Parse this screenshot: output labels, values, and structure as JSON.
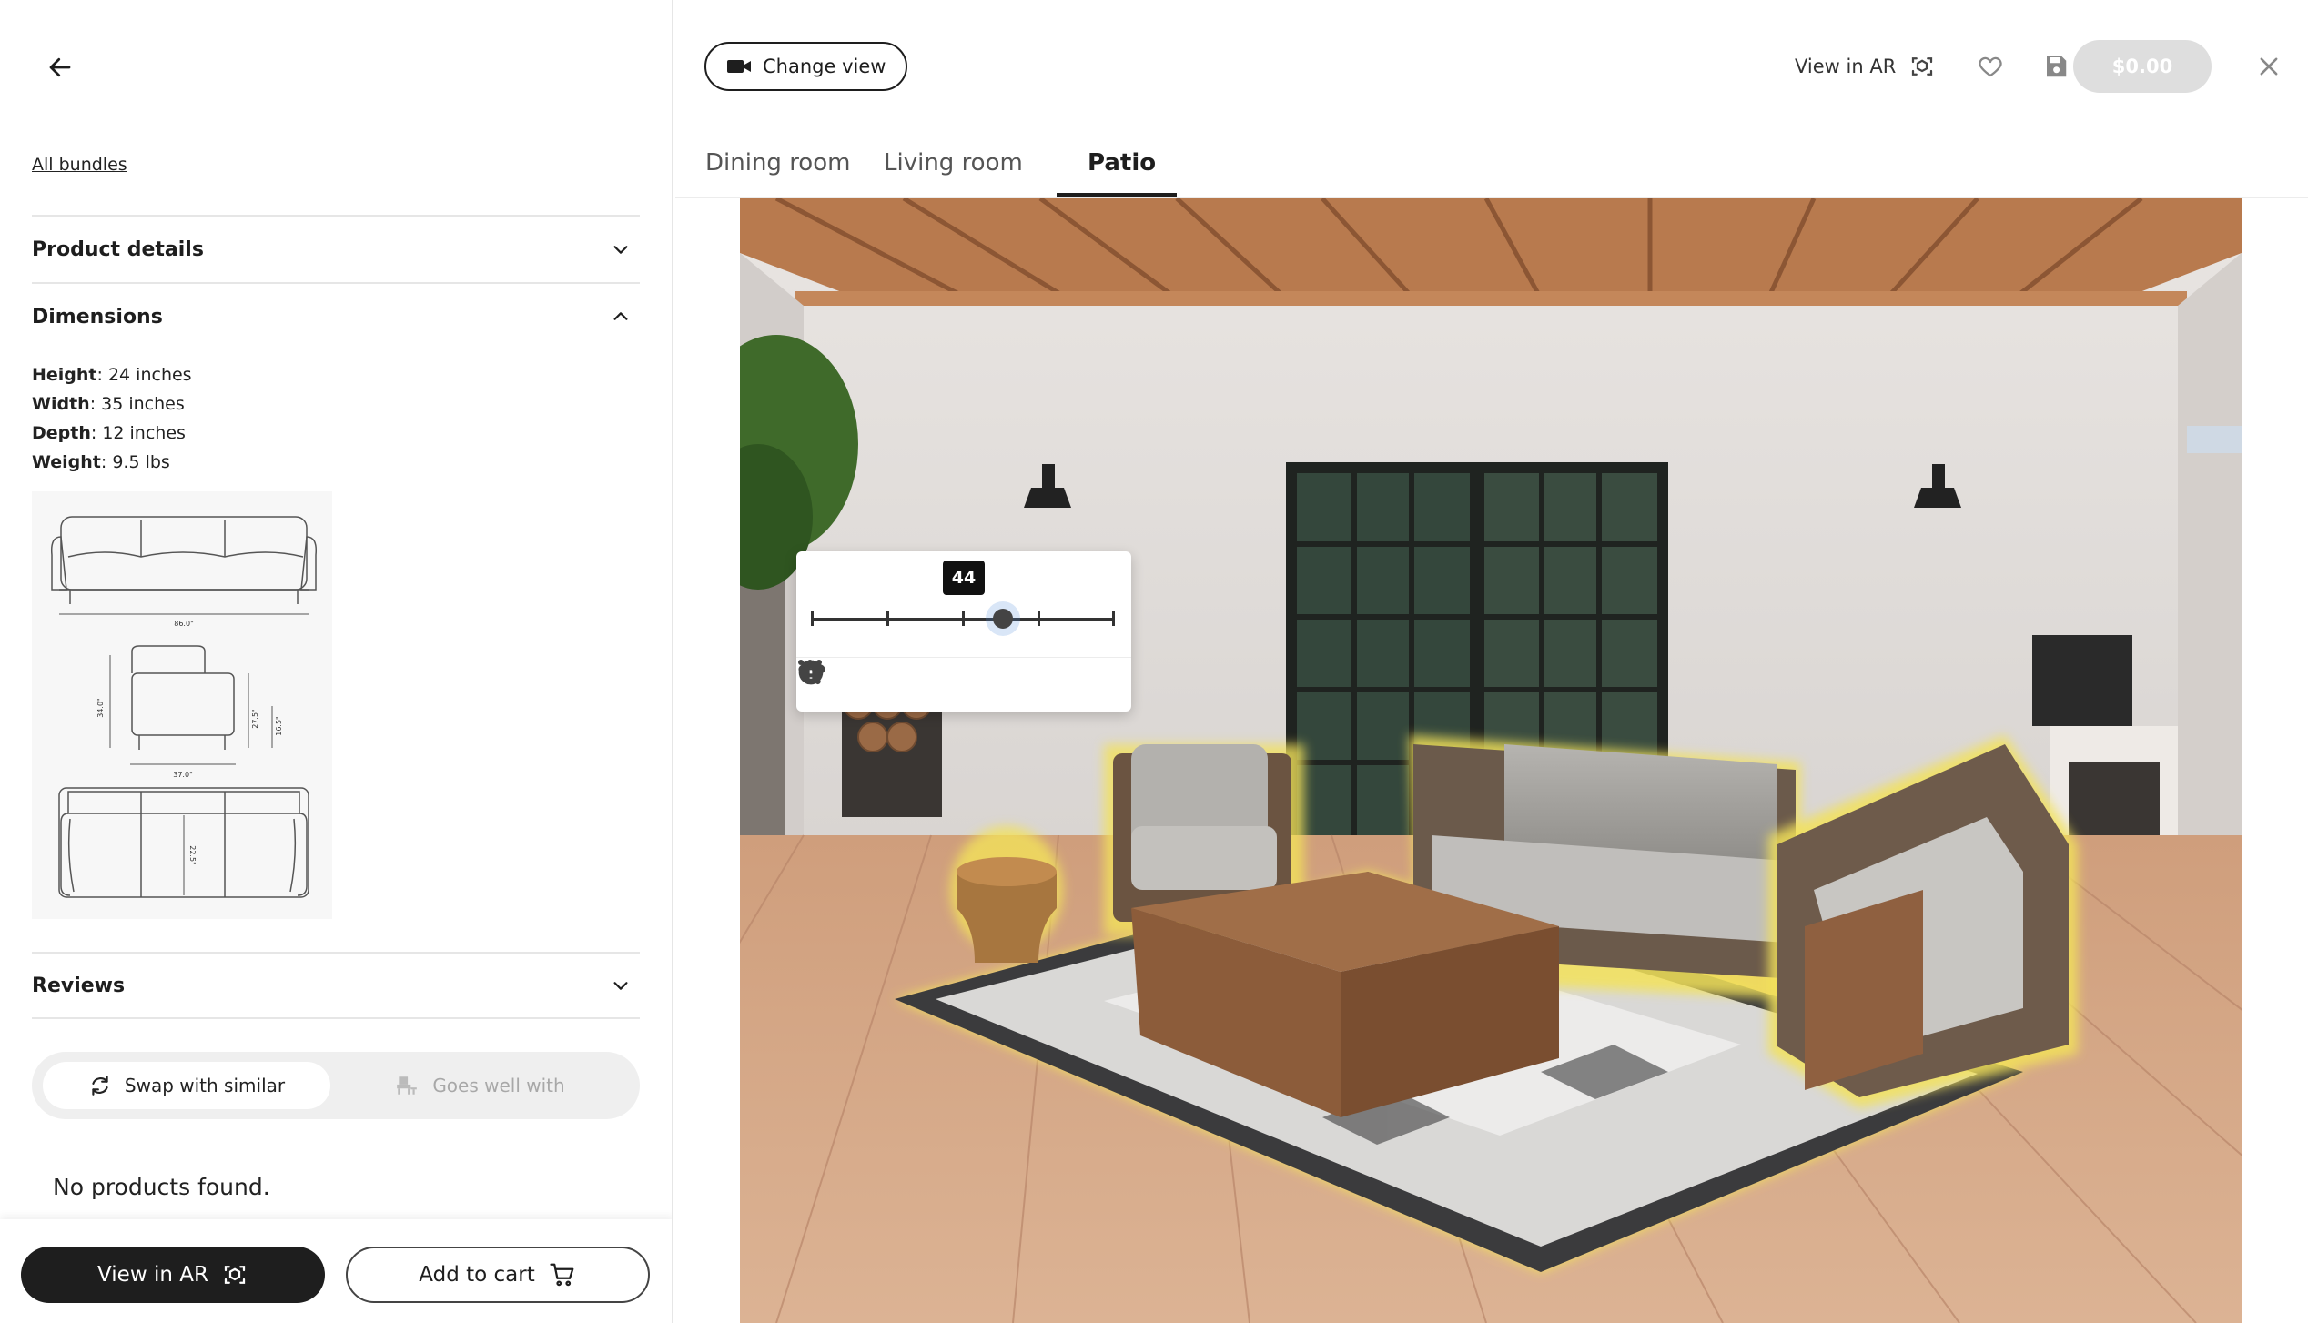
{
  "left": {
    "back_icon": "arrow-left-icon",
    "all_bundles": "All bundles",
    "sections": [
      {
        "label": "Product details",
        "state": "collapsed"
      },
      {
        "label": "Dimensions",
        "state": "expanded"
      },
      {
        "label": "Reviews",
        "state": "collapsed"
      }
    ],
    "dimensions": {
      "height_label": "Height",
      "height_value": ": 24 inches",
      "width_label": "Width",
      "width_value": ": 35 inches",
      "depth_label": "Depth",
      "depth_value": ": 12 inches",
      "weight_label": "Weight",
      "weight_value": ": 9.5 lbs"
    },
    "diagram_labels": {
      "front_width": "86.0\"",
      "side_height": "34.0\"",
      "side_seat_a": "27.5\"",
      "side_seat_b": "16.5\"",
      "side_depth": "37.0\"",
      "top_depth": "22.5\""
    },
    "toggle": {
      "swap_label": "Swap with similar",
      "goes_label": "Goes well with",
      "active": "swap"
    },
    "no_products": "No products found.",
    "view_ar_label": "View in AR",
    "add_to_cart_label": "Add to cart"
  },
  "top": {
    "change_view_label": "Change view",
    "view_ar_label": "View in AR",
    "price": "$0.00"
  },
  "tabs": [
    {
      "label": "Dining room",
      "active": false
    },
    {
      "label": "Living room",
      "active": false
    },
    {
      "label": "Patio",
      "active": true
    }
  ],
  "float_panel": {
    "slider_value": "44",
    "tools": [
      "info-icon",
      "rotate-icon",
      "add-to-cart-icon",
      "swap-icon",
      "more-icon"
    ]
  },
  "colors": {
    "primary": "#1e1e1e",
    "disabled_bg": "#dedede",
    "selection_glow": "#f3e25a"
  }
}
